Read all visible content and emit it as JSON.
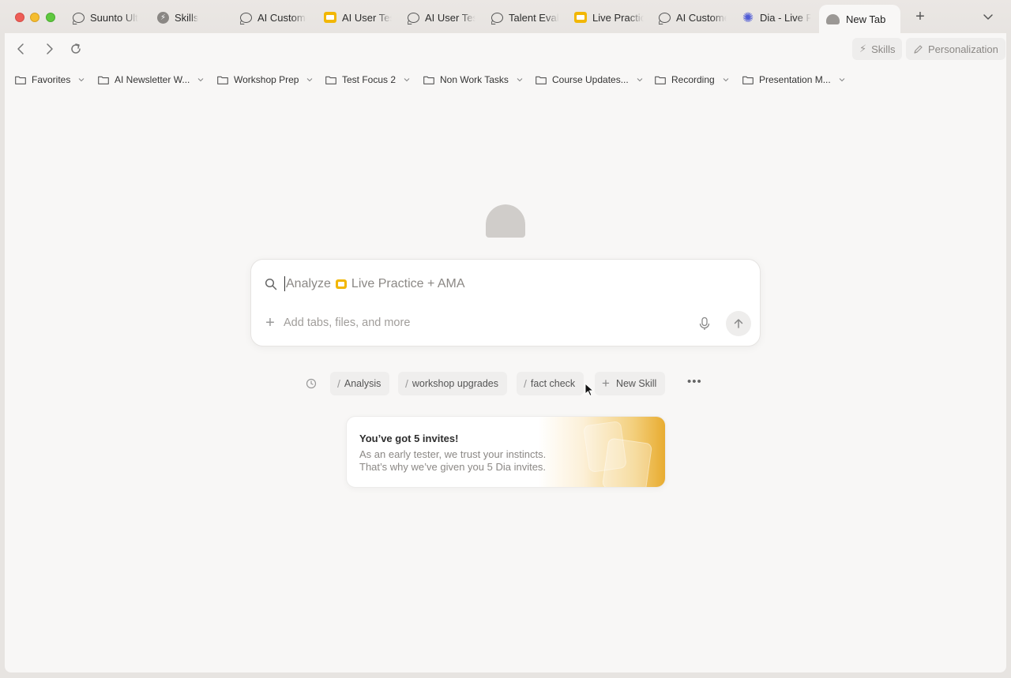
{
  "tabs": [
    {
      "label": "Suunto Ult",
      "icon": "chat-bubble-icon"
    },
    {
      "label": "Skills",
      "icon": "skills-icon"
    },
    {
      "label": "AI Custome",
      "icon": "chat-bubble-icon"
    },
    {
      "label": "AI User Tes",
      "icon": "slides-icon"
    },
    {
      "label": "AI User Tes",
      "icon": "chat-bubble-icon"
    },
    {
      "label": "Talent Eval",
      "icon": "chat-bubble-icon"
    },
    {
      "label": "Live Practic",
      "icon": "slides-icon"
    },
    {
      "label": "AI Custome",
      "icon": "chat-bubble-icon"
    },
    {
      "label": "Dia - Live P",
      "icon": "dia-icon"
    }
  ],
  "active_tab": {
    "label": "New Tab",
    "icon": "new-tab-icon"
  },
  "toolbar": {
    "skills_label": "Skills",
    "personalization_label": "Personalization"
  },
  "bookmarks": [
    {
      "label": "Favorites"
    },
    {
      "label": "AI Newsletter W..."
    },
    {
      "label": "Workshop Prep"
    },
    {
      "label": "Test Focus 2"
    },
    {
      "label": "Non Work Tasks"
    },
    {
      "label": "Course Updates..."
    },
    {
      "label": "Recording"
    },
    {
      "label": "Presentation M..."
    }
  ],
  "search": {
    "prefix": "Analyze",
    "context": "Live Practice + AMA",
    "add_placeholder": "Add tabs, files, and more"
  },
  "skills": [
    {
      "label": "Analysis"
    },
    {
      "label": "workshop upgrades"
    },
    {
      "label": "fact check"
    }
  ],
  "new_skill_label": "New Skill",
  "invite": {
    "title": "You’ve got 5 invites!",
    "line1": "As an early tester, we trust your instincts.",
    "line2": "That’s why we’ve given you 5 Dia invites."
  },
  "colors": {
    "slides_accent": "#f2b705",
    "dia_accent": "#4f5bd5",
    "close": "#ee5e57",
    "minimize": "#f5bd2f",
    "zoom": "#5fc83f"
  }
}
